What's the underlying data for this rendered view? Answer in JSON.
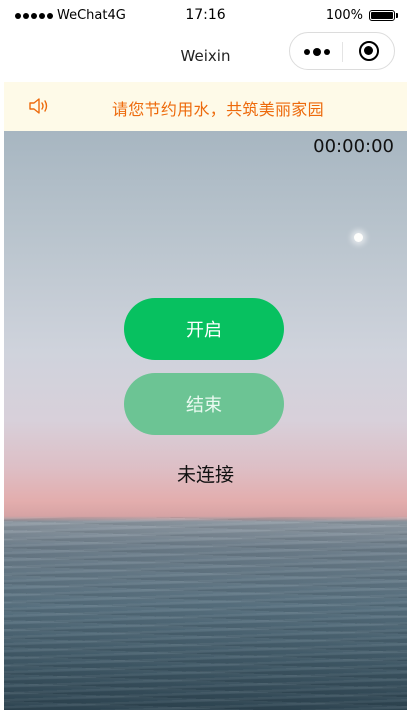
{
  "status_bar": {
    "carrier": "WeChat4G",
    "time": "17:16",
    "battery_text": "100%",
    "battery_level": 1.0,
    "signal_bars": 5
  },
  "nav_bar": {
    "title": "Weixin",
    "menu_icon": "more-dots-icon",
    "close_icon": "target-close-icon"
  },
  "notice": {
    "icon": "speaker-icon",
    "text": "请您节约用水，共筑美丽家园",
    "text_color": "#ed6a0c",
    "background": "#fefae8"
  },
  "main": {
    "timer": "00:00:00",
    "start_button": "开启",
    "end_button": "结束",
    "connection_status": "未连接",
    "start_color": "#07c160",
    "end_color": "#6cc494"
  }
}
